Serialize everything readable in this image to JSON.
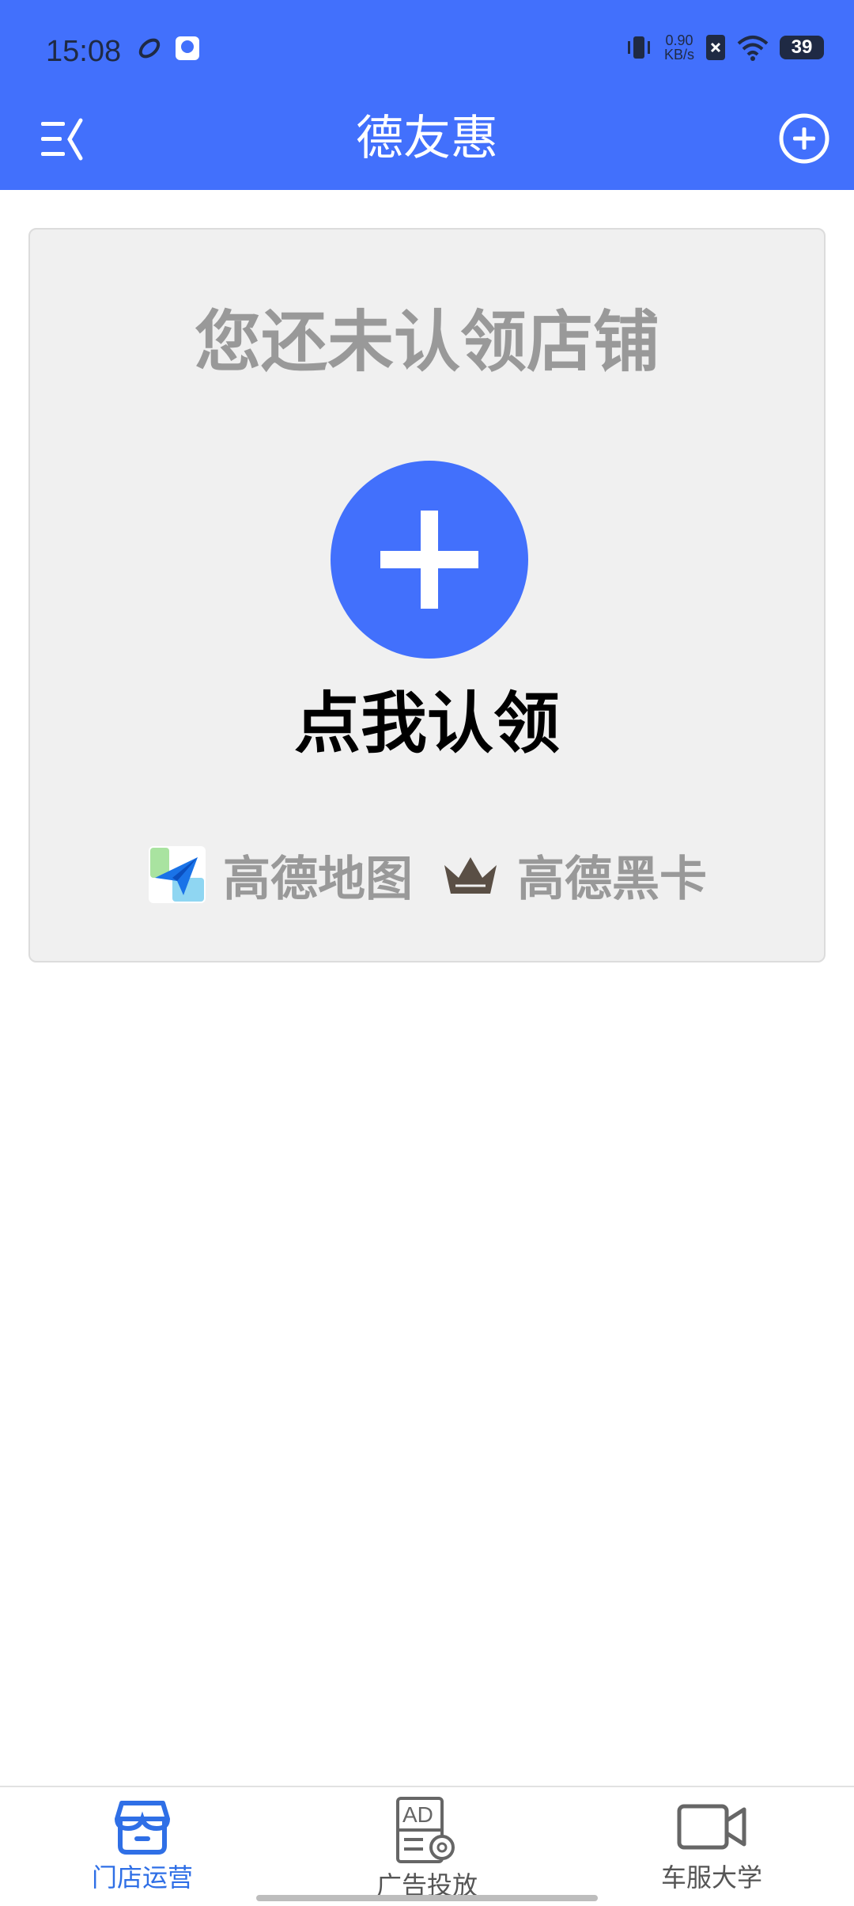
{
  "status": {
    "time": "15:08",
    "net_speed_value": "0.90",
    "net_speed_unit": "KB/s",
    "battery": "39"
  },
  "header": {
    "title": "德友惠",
    "menu_icon": "menu-collapse-icon",
    "add_icon": "plus-circle-icon"
  },
  "claim_card": {
    "title": "您还未认领店铺",
    "action_label": "点我认领",
    "partners": [
      {
        "name": "高德地图",
        "icon": "amap-logo-icon"
      },
      {
        "name": "高德黑卡",
        "icon": "crown-icon"
      }
    ]
  },
  "tabbar": {
    "tabs": [
      {
        "label": "门店运营",
        "icon": "store-icon",
        "active": true
      },
      {
        "label": "广告投放",
        "icon": "ad-settings-icon",
        "active": false
      },
      {
        "label": "车服大学",
        "icon": "video-camera-icon",
        "active": false
      }
    ]
  },
  "colors": {
    "primary": "#4270FC",
    "tab_active": "#2F6FE6",
    "card_bg": "#F0F0F0",
    "muted_text": "#999999"
  }
}
